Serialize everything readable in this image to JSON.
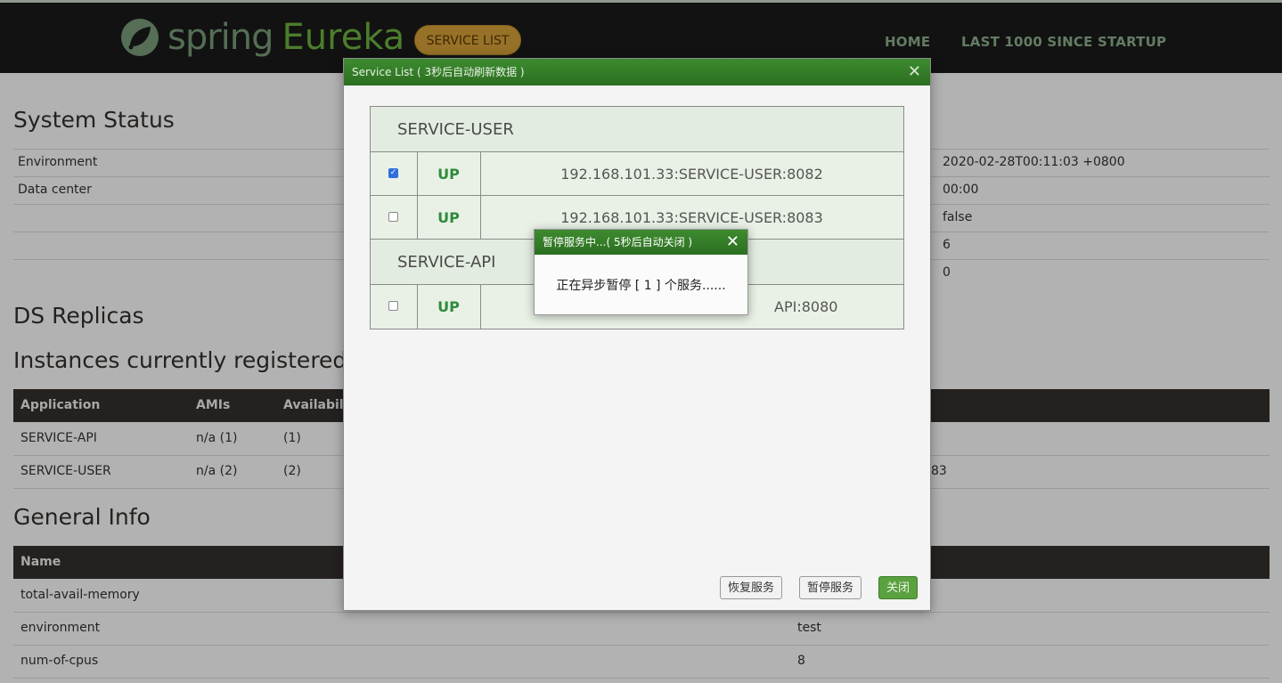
{
  "nav": {
    "logo_spring": "spring",
    "logo_eureka": "Eureka",
    "service_list_btn": "SERVICE LIST",
    "home": "HOME",
    "last1000": "LAST 1000 SINCE STARTUP"
  },
  "system_status": {
    "title": "System Status",
    "rows": [
      {
        "key": "Environment",
        "value": "2020-02-28T00:11:03 +0800"
      },
      {
        "key": "Data center",
        "value": "00:00"
      },
      {
        "key": "",
        "value": "false"
      },
      {
        "key": "",
        "value": "6"
      },
      {
        "key": "",
        "value": "0"
      }
    ]
  },
  "ds_replicas": {
    "title": "DS Replicas"
  },
  "instances": {
    "title": "Instances currently registered",
    "headers": [
      "Application",
      "AMIs",
      "Availabilit"
    ],
    "rows": [
      {
        "app": "SERVICE-API",
        "amis": "n/a (1)",
        "avail": "(1)",
        "status": ""
      },
      {
        "app": "SERVICE-USER",
        "amis": "n/a (2)",
        "avail": "(2)",
        "status": "83"
      }
    ]
  },
  "general_info": {
    "title": "General Info",
    "header": "Name",
    "rows": [
      {
        "name": "total-avail-memory",
        "value": ""
      },
      {
        "name": "environment",
        "value": "test"
      },
      {
        "name": "num-of-cpus",
        "value": "8"
      }
    ]
  },
  "service_dialog": {
    "title": "Service List ( 3秒后自动刷新数据 )",
    "close_glyph": "✕",
    "groups": [
      {
        "name": "SERVICE-USER",
        "instances": [
          {
            "checked": true,
            "status": "UP",
            "id": "192.168.101.33:SERVICE-USER:8082"
          },
          {
            "checked": false,
            "status": "UP",
            "id": "192.168.101.33:SERVICE-USER:8083"
          }
        ]
      },
      {
        "name": "SERVICE-API",
        "instances": [
          {
            "checked": false,
            "status": "UP",
            "id": "API:8080"
          }
        ]
      }
    ],
    "buttons": {
      "resume": "恢复服务",
      "pause": "暂停服务",
      "close": "关闭"
    }
  },
  "toast": {
    "title": "暂停服务中...( 5秒后自动关闭 )",
    "close_glyph": "✕",
    "message": "正在异步暂停 [ 1 ] 个服务......"
  },
  "colors": {
    "brand_green": "#6db33f",
    "title_bar_green": "#2c6e21",
    "status_up": "#2e8b3a",
    "nav_bg": "#1b1b1b"
  }
}
